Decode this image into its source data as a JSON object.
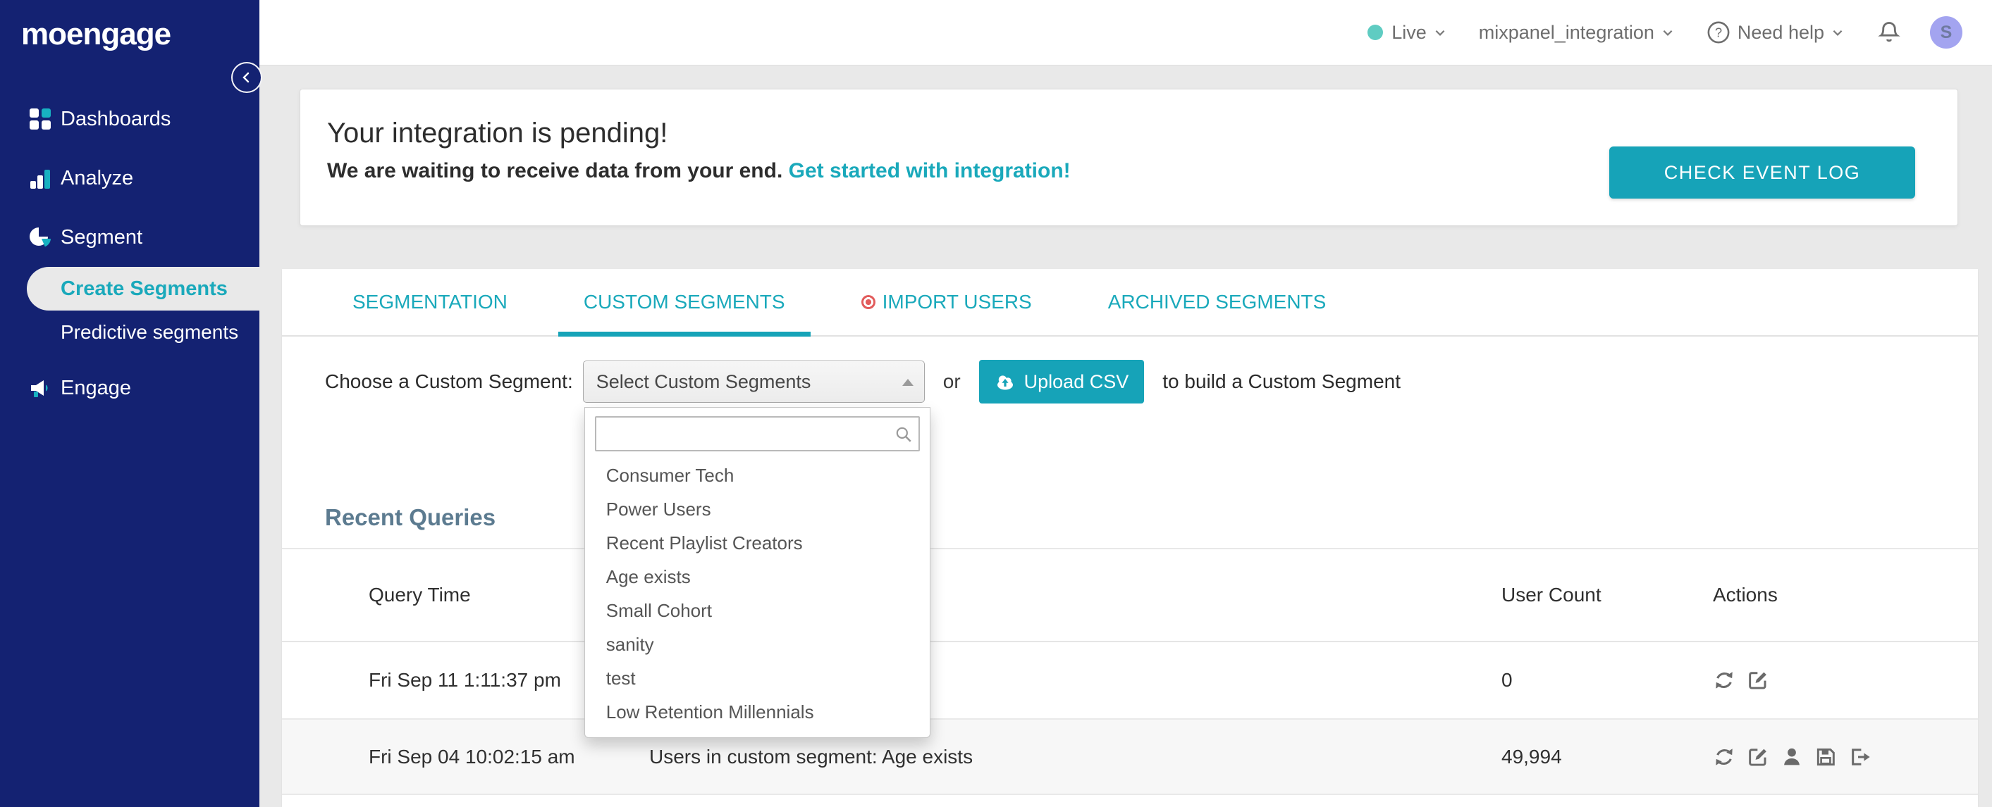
{
  "colors": {
    "brand_navy": "#142272",
    "accent_teal": "#16a3b8",
    "teal_text": "#1aa9bb",
    "alert_red": "#e25c5c",
    "live_dot": "#5fccc2",
    "avatar_bg": "#a3a4f0",
    "heading_slate": "#5c7b90"
  },
  "brand": {
    "logo": "moengage"
  },
  "topbar": {
    "environment": {
      "label": "Live"
    },
    "workspace": {
      "label": "mixpanel_integration"
    },
    "help": {
      "label": "Need help"
    },
    "avatar": {
      "initial": "S"
    }
  },
  "sidebar": {
    "items": [
      {
        "label": "Dashboards",
        "icon": "dashboard-grid-icon"
      },
      {
        "label": "Analyze",
        "icon": "bar-chart-icon"
      },
      {
        "label": "Segment",
        "icon": "pie-chart-icon"
      },
      {
        "label": "Engage",
        "icon": "megaphone-icon"
      }
    ],
    "segment_children": [
      {
        "label": "Create Segments",
        "active": true
      },
      {
        "label": "Predictive segments",
        "active": false
      }
    ]
  },
  "banner": {
    "title": "Your integration is pending!",
    "subtitle": "We are waiting to receive data from your end.",
    "link": "Get started with integration!",
    "button": "CHECK EVENT LOG"
  },
  "tabs": [
    {
      "label": "SEGMENTATION",
      "active": false
    },
    {
      "label": "CUSTOM SEGMENTS",
      "active": true
    },
    {
      "label": "IMPORT USERS",
      "active": false,
      "badge": "red-target-icon"
    },
    {
      "label": "ARCHIVED SEGMENTS",
      "active": false
    }
  ],
  "segment_chooser": {
    "label": "Choose a Custom Segment:",
    "select_value": "Select Custom Segments",
    "or_text": "or",
    "upload_button": "Upload CSV",
    "suffix_text": "to build a Custom Segment",
    "dropdown": {
      "search_value": "",
      "options": [
        "Consumer Tech",
        "Power Users",
        "Recent Playlist Creators",
        "Age exists",
        "Small Cohort",
        "sanity",
        "test",
        "Low Retention Millennials"
      ]
    }
  },
  "recent_queries": {
    "title": "Recent Queries",
    "columns": [
      "Query Time",
      "User Count",
      "Actions"
    ],
    "rows": [
      {
        "query_time": "Fri Sep 11 1:11:37 pm",
        "description": "",
        "user_count": "0",
        "actions": [
          "refresh",
          "edit"
        ]
      },
      {
        "query_time": "Fri Sep 04 10:02:15 am",
        "description": "Users in custom segment: Age exists",
        "user_count": "49,994",
        "actions": [
          "refresh",
          "edit",
          "user",
          "save",
          "export"
        ]
      }
    ]
  }
}
